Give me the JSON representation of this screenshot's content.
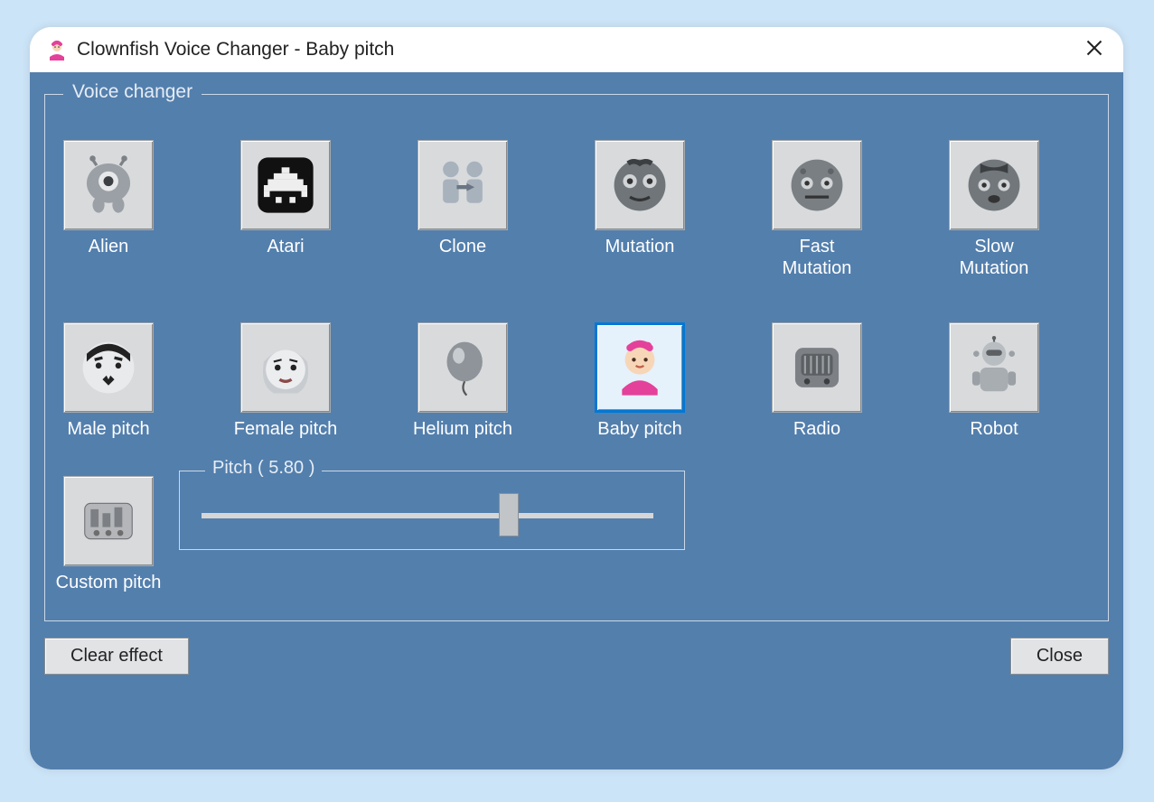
{
  "window": {
    "title": "Clownfish Voice Changer - Baby pitch"
  },
  "groupbox": {
    "label": "Voice changer"
  },
  "voices": [
    {
      "id": "alien",
      "label": "Alien",
      "icon": "alien-icon",
      "selected": false
    },
    {
      "id": "atari",
      "label": "Atari",
      "icon": "atari-icon",
      "selected": false
    },
    {
      "id": "clone",
      "label": "Clone",
      "icon": "clone-icon",
      "selected": false
    },
    {
      "id": "mutation",
      "label": "Mutation",
      "icon": "mutation-icon",
      "selected": false
    },
    {
      "id": "fast-mutation",
      "label": "Fast\nMutation",
      "icon": "fast-mutation-icon",
      "selected": false
    },
    {
      "id": "slow-mutation",
      "label": "Slow\nMutation",
      "icon": "slow-mutation-icon",
      "selected": false
    },
    {
      "id": "male-pitch",
      "label": "Male pitch",
      "icon": "male-pitch-icon",
      "selected": false
    },
    {
      "id": "female-pitch",
      "label": "Female pitch",
      "icon": "female-pitch-icon",
      "selected": false
    },
    {
      "id": "helium-pitch",
      "label": "Helium pitch",
      "icon": "helium-pitch-icon",
      "selected": false
    },
    {
      "id": "baby-pitch",
      "label": "Baby pitch",
      "icon": "baby-pitch-icon",
      "selected": true
    },
    {
      "id": "radio",
      "label": "Radio",
      "icon": "radio-icon",
      "selected": false
    },
    {
      "id": "robot",
      "label": "Robot",
      "icon": "robot-icon",
      "selected": false
    }
  ],
  "custom_pitch": {
    "label": "Custom pitch",
    "icon": "custom-pitch-icon"
  },
  "pitch": {
    "label": "Pitch ( 5.80 )",
    "value": 5.8,
    "min": 0,
    "max": 10,
    "thumb_percent": 68
  },
  "buttons": {
    "clear_effect": "Clear effect",
    "close": "Close"
  }
}
